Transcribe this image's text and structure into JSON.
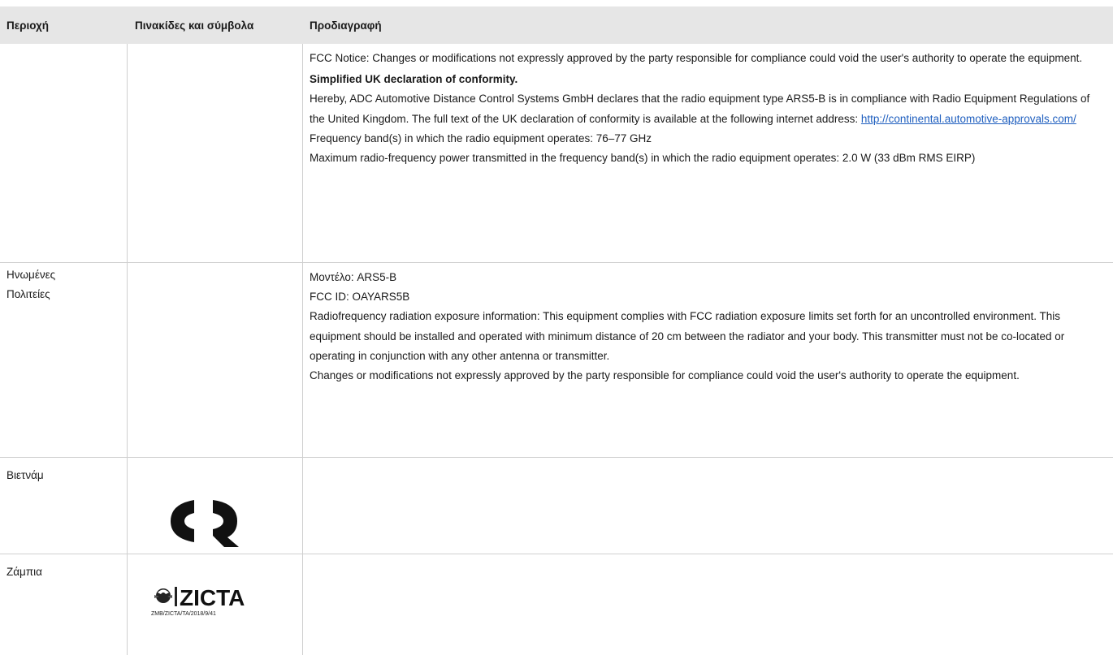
{
  "table": {
    "headers": {
      "region": "Περιοχή",
      "labels_symbols": "Πινακίδες και σύμβολα",
      "specification": "Προδιαγραφή"
    },
    "rows": [
      {
        "region": "",
        "spec": {
          "fcc_notice": "FCC Notice: Changes or modifications not expressly approved by the party responsible for compliance could void the user's authority to operate the equipment.",
          "uk_heading": "Simplified UK declaration of conformity.",
          "uk_text": "Hereby, ADC Automotive Distance Control Systems GmbH declares that the radio equipment type ARS5-B is in compliance with Radio Equipment Regulations of the United Kingdom. The full text of the UK declaration of conformity is available at the following internet address:",
          "uk_link": "http://continental.automotive-approvals.com/",
          "frequency": "Frequency band(s) in which the radio equipment operates: 76–77 GHz",
          "power": "Maximum radio-frequency power transmitted in the frequency band(s) in which the radio equipment operates: 2.0 W (33 dBm RMS EIRP)"
        }
      },
      {
        "region_line1": "Ηνωμένες",
        "region_line2": "Πολιτείες",
        "spec": {
          "model": "Μοντέλο: ARS5-B",
          "fcc_id": "FCC ID: OAYARS5B",
          "rf_exposure": "Radiofrequency radiation exposure information: This equipment complies with FCC radiation exposure limits set forth for an uncontrolled environment. This equipment should be installed and operated with minimum distance of 20 cm between the radiator and your body. This transmitter must not be co-located or operating in conjunction with any other antenna or transmitter.",
          "changes": "Changes or modifications not expressly approved by the party responsible for compliance could void the user's authority to operate the equipment."
        }
      },
      {
        "region": "Βιετνάμ",
        "symbol": "vietnam-cr-mark-icon"
      },
      {
        "region": "Ζάμπια",
        "symbol": "zicta-logo-icon",
        "symbol_text": "ZICTA",
        "symbol_code": "ZMB/ZICTA/TA/2018/9/41"
      }
    ]
  },
  "colors": {
    "header_bg": "#e6e6e6",
    "border": "#cfcfcf",
    "link": "#1f5fbf"
  }
}
